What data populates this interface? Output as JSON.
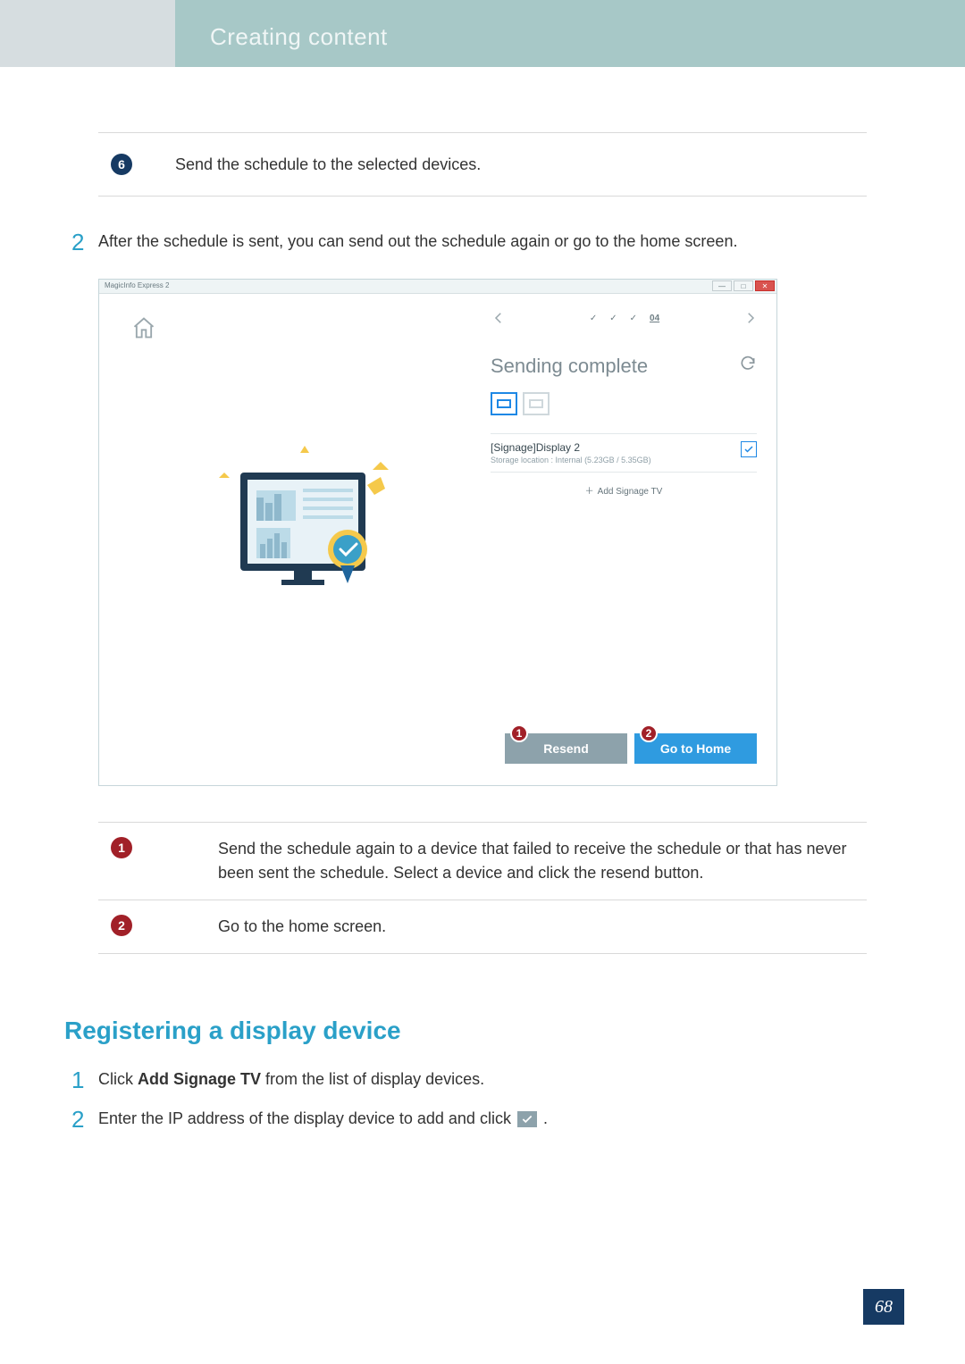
{
  "header": {
    "title": "Creating content"
  },
  "callouts": {
    "six": {
      "num": "6",
      "text": "Send the schedule to the selected devices."
    },
    "one": {
      "num": "1",
      "text": "Send the schedule again to a device that failed to receive the schedule or that has never been sent the schedule. Select a device and click the resend button."
    },
    "two": {
      "num": "2",
      "text": "Go to the home screen."
    }
  },
  "steps": {
    "two_num": "2",
    "two_text": "After the schedule is sent, you can send out the schedule again or go to the home screen."
  },
  "screenshot": {
    "window_title": "MagicInfo Express 2",
    "step_current": "04",
    "title": "Sending complete",
    "device_name": "[Signage]Display 2",
    "device_storage": "Storage location : Internal (5.23GB / 5.35GB)",
    "add_signage": "Add Signage TV",
    "buttons": {
      "resend": "Resend",
      "goto_home": "Go to Home"
    },
    "callouts": {
      "one": "1",
      "two": "2"
    }
  },
  "section2": {
    "heading": "Registering a display device",
    "step1_num": "1",
    "step1_pre": "Click ",
    "step1_bold": "Add Signage TV",
    "step1_post": " from the list of display devices.",
    "step2_num": "2",
    "step2_text": "Enter the IP address of the display device to add and click "
  },
  "page_number": "68"
}
